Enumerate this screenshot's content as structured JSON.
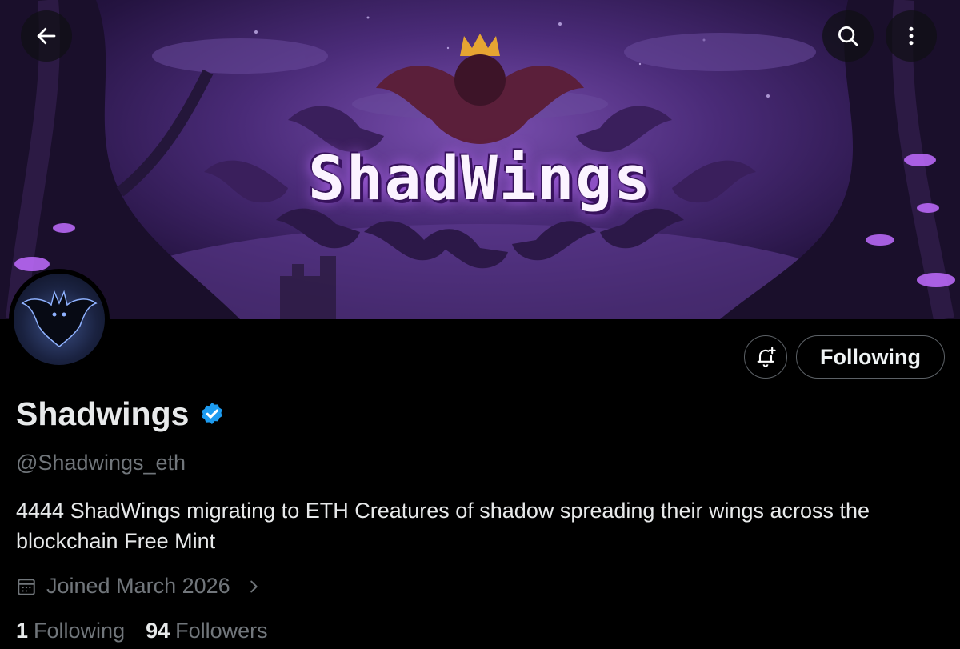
{
  "banner": {
    "title_text": "ShadWings"
  },
  "profile": {
    "display_name": "Shadwings",
    "handle": "@Shadwings_eth",
    "bio": "4444 ShadWings migrating to ETH Creatures of shadow spreading their wings across the blockchain Free Mint",
    "joined": "Joined March 2026",
    "following_count": "1",
    "following_label": "Following",
    "followers_count": "94",
    "followers_label": "Followers",
    "verified_color": "#1d9bf0"
  },
  "actions": {
    "follow_label": "Following"
  },
  "icons": [
    "back-arrow-icon",
    "search-icon",
    "more-vertical-icon",
    "bell-plus-icon",
    "verified-badge-icon",
    "calendar-icon",
    "chevron-right-icon"
  ]
}
